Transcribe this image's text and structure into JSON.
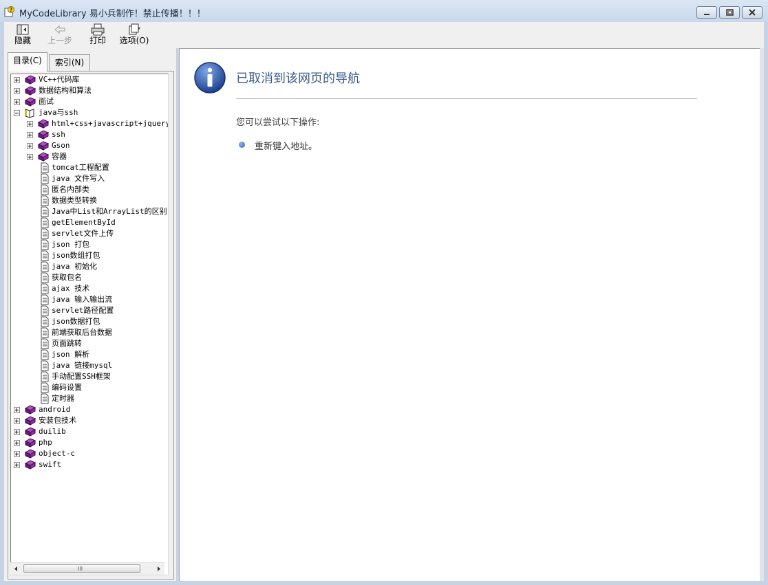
{
  "window": {
    "title": "MyCodeLibrary 易小兵制作！禁止传播！！！"
  },
  "toolbar": {
    "hide_label": "隐藏",
    "back_label": "上一步",
    "print_label": "打印",
    "options_label": "选项(O)"
  },
  "tabs": {
    "contents": "目录(C)",
    "index": "索引(N)"
  },
  "tree": {
    "top_items": [
      {
        "label": "VC++代码库",
        "expanded": false
      },
      {
        "label": "数据结构和算法",
        "expanded": false
      },
      {
        "label": "面试",
        "expanded": false
      },
      {
        "label": "java与ssh",
        "expanded": true
      }
    ],
    "java_folders": [
      {
        "label": "html+css+javascript+jquery+e"
      },
      {
        "label": "ssh"
      },
      {
        "label": "Gson"
      },
      {
        "label": "容器"
      }
    ],
    "java_pages": [
      "tomcat工程配置",
      "java 文件写入",
      "匿名内部类",
      "数据类型转换",
      "Java中List和ArrayList的区别",
      "getElementById",
      "servlet文件上传",
      "json 打包",
      "json数组打包",
      "java 初始化",
      "获取包名",
      "ajax 技术",
      "java 输入输出流",
      "servlet路径配置",
      "json数据打包",
      "前端获取后台数据",
      "页面跳转",
      "json 解析",
      "java 链接mysql",
      "手动配置SSH框架",
      "编码设置",
      "定时器"
    ],
    "bottom_items": [
      {
        "label": "android"
      },
      {
        "label": "安装包技术"
      },
      {
        "label": "duilib"
      },
      {
        "label": "php"
      },
      {
        "label": "object-c"
      },
      {
        "label": "swift"
      }
    ],
    "scroll_grip": "III"
  },
  "content": {
    "heading": "已取消到该网页的导航",
    "try_text": "您可以尝试以下操作:",
    "retry_text": "重新键入地址。"
  },
  "colors": {
    "heading": "#3b5c8a",
    "book": "#7b2a8c",
    "window_frame": "#c5d3e4"
  }
}
